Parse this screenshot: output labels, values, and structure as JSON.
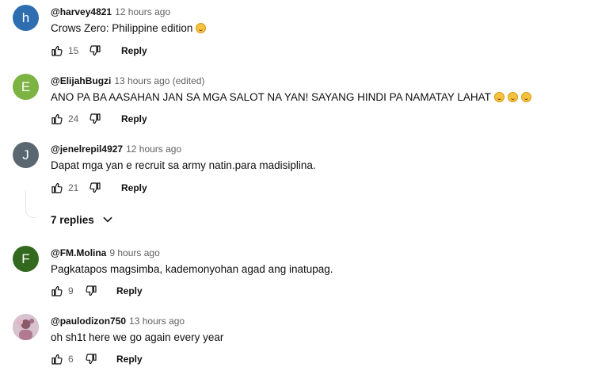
{
  "comments": [
    {
      "avatar_letter": "h",
      "avatar_color": "#2e6db0",
      "author": "@harvey4821",
      "time": "12 hours ago",
      "text": "Crows Zero: Philippine edition",
      "emoji_count": 1,
      "likes": "15",
      "reply_label": "Reply"
    },
    {
      "avatar_letter": "E",
      "avatar_color": "#7cb342",
      "author": "@ElijahBugzi",
      "time": "13 hours ago (edited)",
      "text": "ANO PA BA AASAHAN JAN SA MGA SALOT NA YAN! SAYANG HINDI PA NAMATAY LAHAT",
      "emoji_count": 3,
      "likes": "24",
      "reply_label": "Reply"
    },
    {
      "avatar_letter": "J",
      "avatar_color": "#5b6770",
      "author": "@jenelrepil4927",
      "time": "12 hours ago",
      "text": "Dapat mga yan e recruit sa army natin.para madisiplina.",
      "emoji_count": 0,
      "likes": "21",
      "reply_label": "Reply"
    },
    {
      "avatar_letter": "F",
      "avatar_color": "#33691e",
      "author": "@FM.Molina",
      "time": "9 hours ago",
      "text": "Pagkatapos magsimba, kademonyohan agad ang inatupag.",
      "emoji_count": 0,
      "likes": "9",
      "reply_label": "Reply"
    },
    {
      "avatar_letter": "",
      "avatar_color": "#c9a3b6",
      "author": "@paulodizon750",
      "time": "13 hours ago",
      "text": "oh sh1t here we go again every year",
      "emoji_count": 0,
      "likes": "6",
      "reply_label": "Reply"
    }
  ],
  "replies_toggle": {
    "label": "7 replies"
  },
  "icons": {
    "like": "thumbs-up-icon",
    "dislike": "thumbs-down-icon",
    "expand": "chevron-down-icon"
  }
}
